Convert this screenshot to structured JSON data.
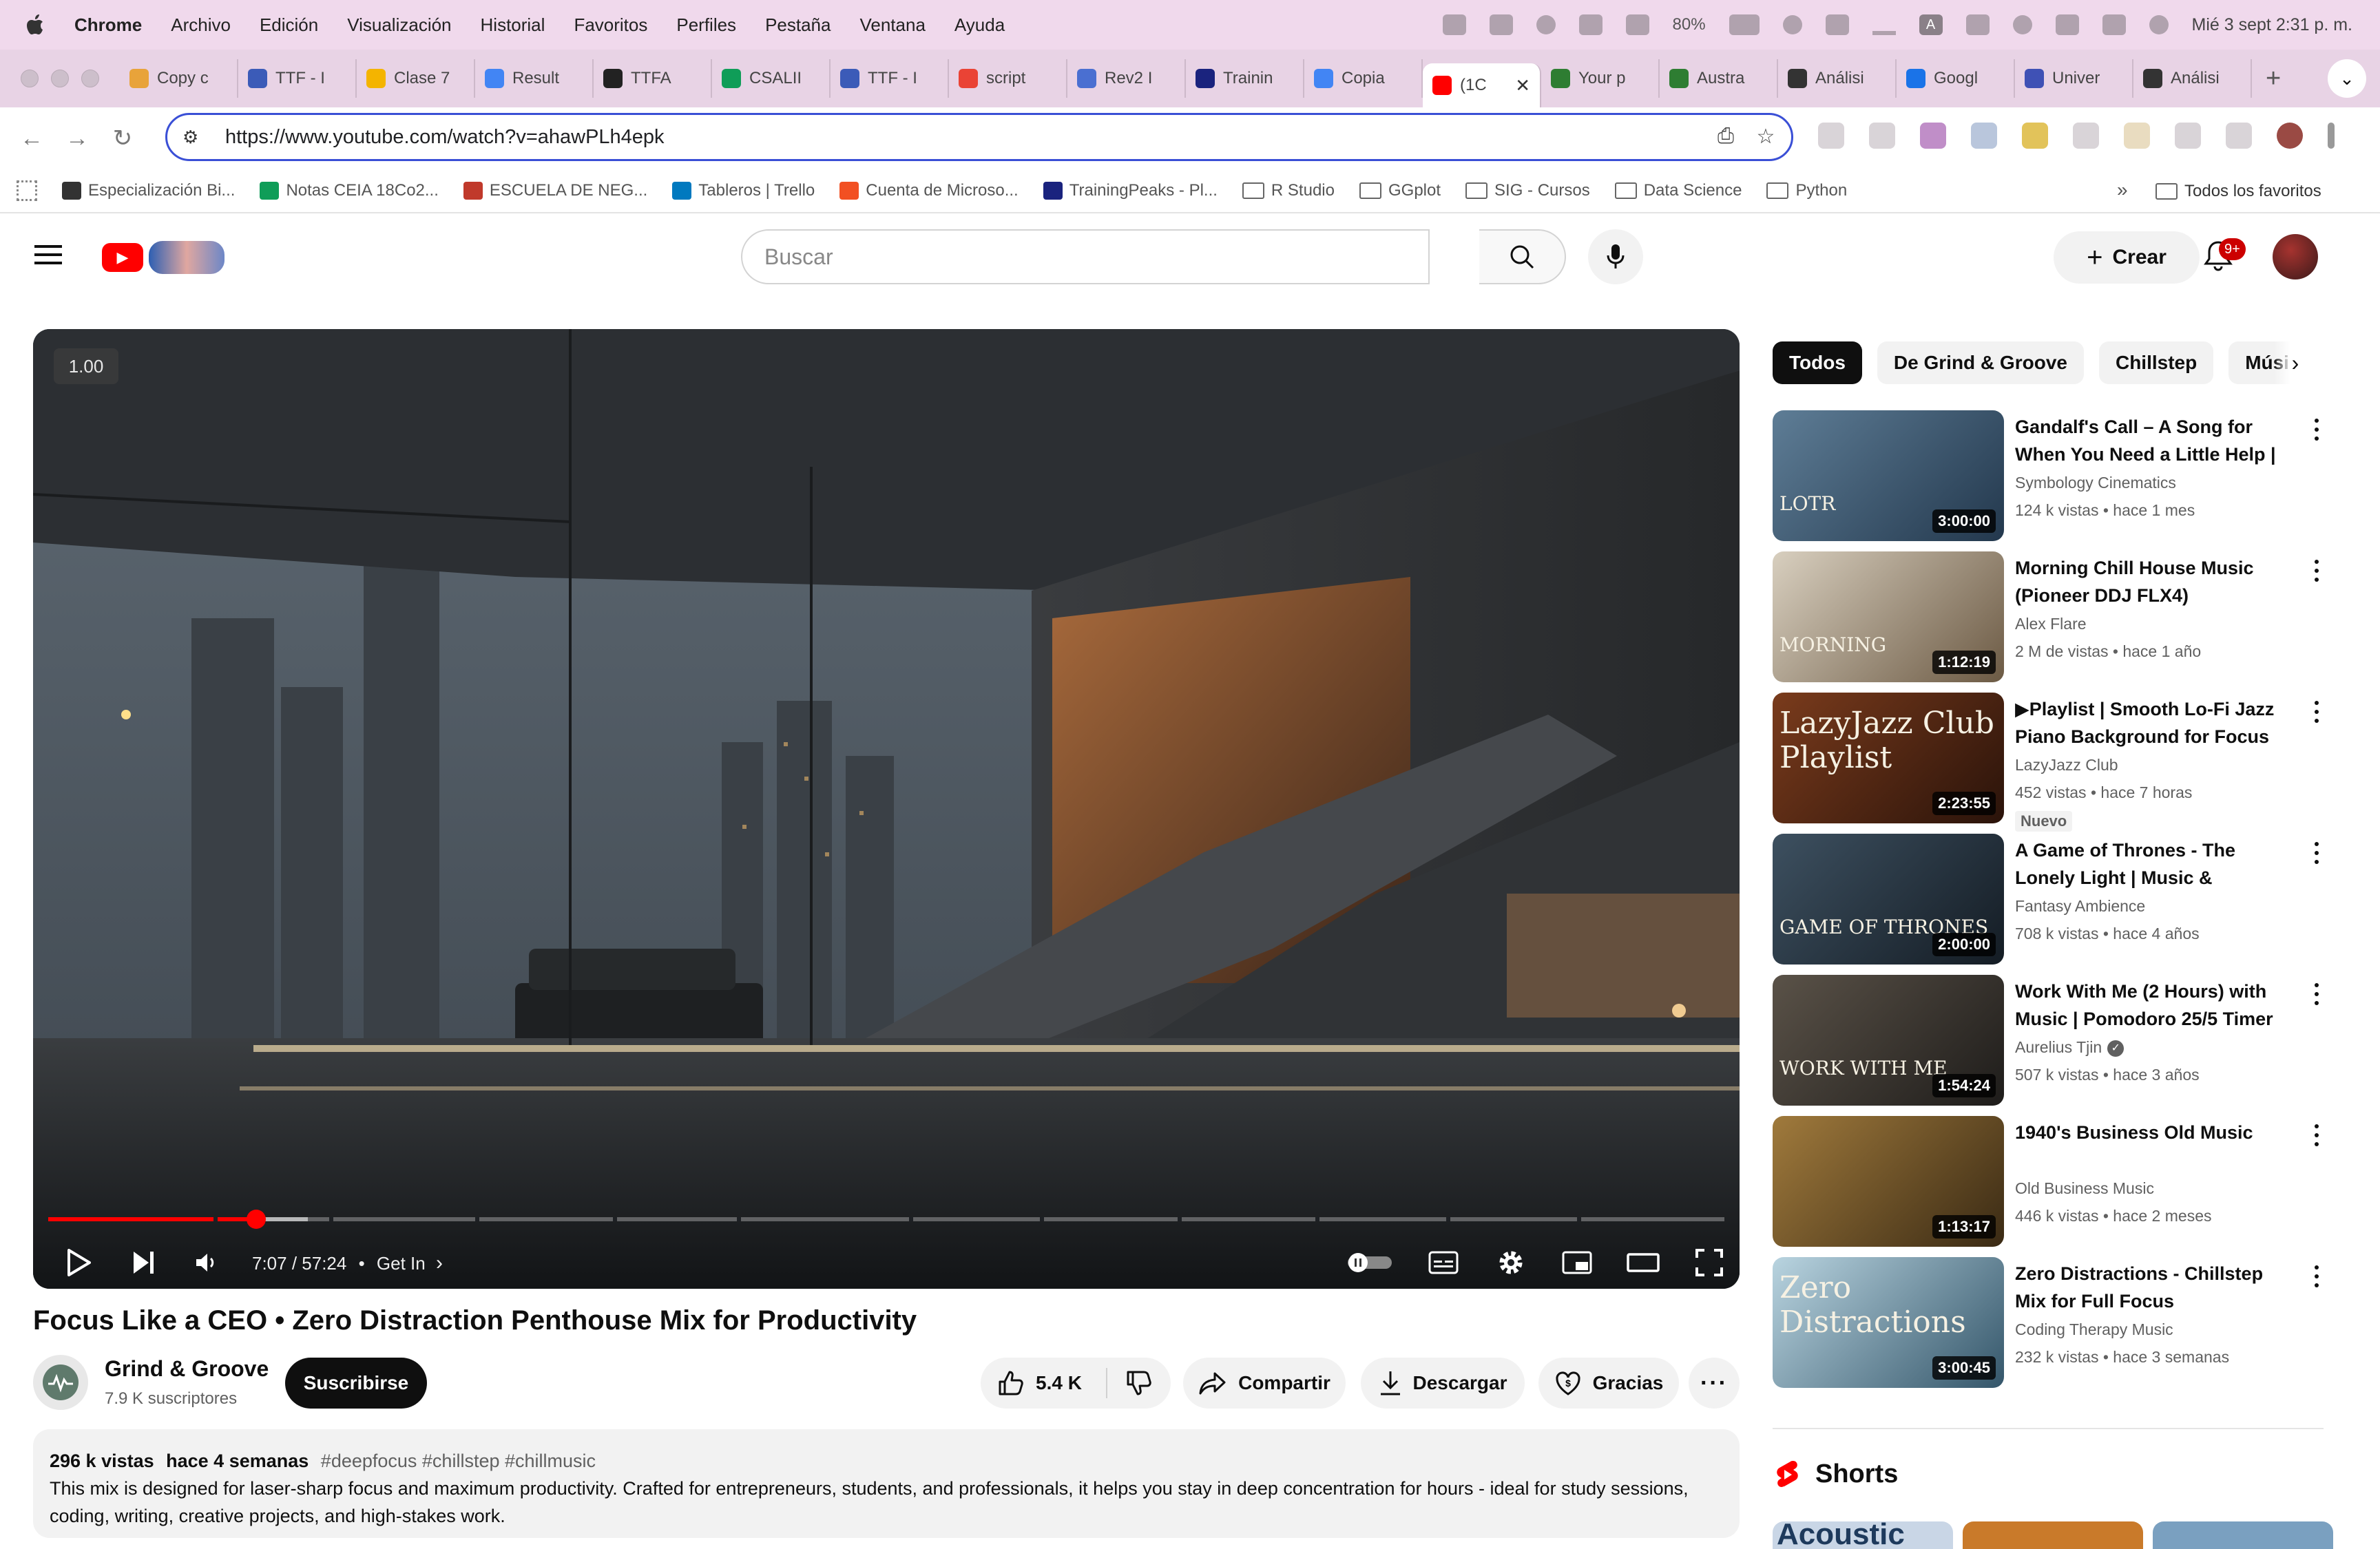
{
  "macos_menubar": {
    "app_name": "Chrome",
    "menus": [
      "Archivo",
      "Edición",
      "Visualización",
      "Historial",
      "Favoritos",
      "Perfiles",
      "Pestaña",
      "Ventana",
      "Ayuda"
    ],
    "battery": "80%",
    "status_initial": "A",
    "datetime": "Mié 3 sept  2:31 p. m."
  },
  "tabs": [
    {
      "label": "Copy c",
      "color": "#e8a33a"
    },
    {
      "label": "TTF - I",
      "color": "#3b5bb8"
    },
    {
      "label": "Clase 7",
      "color": "#f4b400"
    },
    {
      "label": "Result",
      "color": "#4285f4"
    },
    {
      "label": "TTFA",
      "color": "#222222"
    },
    {
      "label": "CSALII",
      "color": "#0f9d58"
    },
    {
      "label": "TTF - I",
      "color": "#3b5bb8"
    },
    {
      "label": "script",
      "color": "#ea4335"
    },
    {
      "label": "Rev2 I",
      "color": "#4a6fd1"
    },
    {
      "label": "Trainin",
      "color": "#1a237e"
    },
    {
      "label": "Copia",
      "color": "#4285f4"
    },
    {
      "label": "(1C",
      "color": "#ff0000",
      "active": true
    },
    {
      "label": "Your p",
      "color": "#2e7d32"
    },
    {
      "label": "Austra",
      "color": "#2e7d32"
    },
    {
      "label": "Análisi",
      "color": "#333333"
    },
    {
      "label": "Googl",
      "color": "#1a73e8"
    },
    {
      "label": "Univer",
      "color": "#3f51b5"
    },
    {
      "label": "Análisi",
      "color": "#333333"
    }
  ],
  "address": {
    "url": "https://www.youtube.com/watch?v=ahawPLh4epk"
  },
  "bookmarks": [
    {
      "label": "Especialización Bi...",
      "icon": "notion"
    },
    {
      "label": "Notas CEIA 18Co2...",
      "icon": "sheets"
    },
    {
      "label": "ESCUELA DE NEG...",
      "icon": "school"
    },
    {
      "label": "Tableros | Trello",
      "icon": "trello"
    },
    {
      "label": "Cuenta de Microso...",
      "icon": "microsoft"
    },
    {
      "label": "TrainingPeaks - Pl...",
      "icon": "trainingpeaks"
    },
    {
      "label": "R Studio",
      "icon": "folder"
    },
    {
      "label": "GGplot",
      "icon": "folder"
    },
    {
      "label": "SIG - Cursos",
      "icon": "folder"
    },
    {
      "label": "Data Science",
      "icon": "folder"
    },
    {
      "label": "Python",
      "icon": "folder"
    }
  ],
  "bookmarks_more": "»",
  "all_bookmarks": "Todos los favoritos",
  "youtube": {
    "search_placeholder": "Buscar",
    "create_label": "Crear",
    "notifications_count": "9+"
  },
  "player": {
    "speed": "1.00",
    "time": "7:07 / 57:24",
    "chapter": "Get In",
    "progress_fraction": 0.124,
    "buffered_fraction": 0.155
  },
  "video": {
    "title": "Focus Like a CEO • Zero Distraction Penthouse Mix for Productivity",
    "channel": "Grind & Groove",
    "subscribers": "7.9 K suscriptores",
    "subscribe_label": "Suscribirse",
    "likes": "5.4 K",
    "share_label": "Compartir",
    "download_label": "Descargar",
    "thanks_label": "Gracias",
    "views": "296 k vistas",
    "age": "hace 4 semanas",
    "tags": "#deepfocus #chillstep #chillmusic",
    "description": "This mix is designed for laser-sharp focus and maximum productivity. Crafted for entrepreneurs, students, and professionals, it helps you stay in deep concentration for hours - ideal for study sessions, coding, writing, creative projects, and high-stakes work."
  },
  "chips": [
    "Todos",
    "De Grind & Groove",
    "Chillstep",
    "Músi"
  ],
  "recommendations": [
    {
      "title": "Gandalf's Call – A Song for When You Need a Little Help | ...",
      "channel": "Symbology Cinematics",
      "views": "124 k vistas",
      "age": "hace 1 mes",
      "duration": "3:00:00",
      "thumb_colors": [
        "#5e7d96",
        "#23384d"
      ],
      "thumb_text": "LOTR"
    },
    {
      "title": "Morning Chill House Music (Pioneer DDJ FLX4)",
      "channel": "Alex Flare",
      "views": "2 M de vistas",
      "age": "hace 1 año",
      "duration": "1:12:19",
      "thumb_colors": [
        "#d8cfbf",
        "#6c5a44"
      ],
      "thumb_text": "MORNING"
    },
    {
      "title": "▶Playlist | Smooth Lo-Fi Jazz Piano Background for Focus &...",
      "channel": "LazyJazz Club",
      "views": "452 vistas",
      "age": "hace 7 horas",
      "duration": "2:23:55",
      "badge": "Nuevo",
      "thumb_colors": [
        "#7a3b1c",
        "#2a130a"
      ],
      "thumb_text": "LazyJazz Club Playlist"
    },
    {
      "title": "A Game of Thrones - The Lonely Light | Music & Ambience ...",
      "channel": "Fantasy Ambience",
      "views": "708 k vistas",
      "age": "hace 4 años",
      "duration": "2:00:00",
      "thumb_colors": [
        "#3d5060",
        "#141c24"
      ],
      "thumb_text": "GAME OF THRONES"
    },
    {
      "title": "Work With Me (2 Hours) with Music | Pomodoro 25/5 Timer ...",
      "channel": "Aurelius Tjin",
      "verified": true,
      "views": "507 k vistas",
      "age": "hace 3 años",
      "duration": "1:54:24",
      "thumb_colors": [
        "#5a5248",
        "#1e1c1a"
      ],
      "thumb_text": "WORK WITH ME"
    },
    {
      "title": "1940's Business Old Music",
      "channel": "Old Business Music",
      "views": "446 k vistas",
      "age": "hace 2 meses",
      "duration": "1:13:17",
      "thumb_colors": [
        "#a07a3c",
        "#3a2a14"
      ],
      "thumb_text": ""
    },
    {
      "title": "Zero Distractions - Chillstep Mix for Full Focus",
      "channel": "Coding Therapy Music",
      "views": "232 k vistas",
      "age": "hace 3 semanas",
      "duration": "3:00:45",
      "thumb_colors": [
        "#b9d4e0",
        "#34566a"
      ],
      "thumb_text": "Zero Distractions"
    }
  ],
  "shorts": {
    "title": "Shorts",
    "thumb_colors": [
      "#c9d6e6",
      "#c97a2a",
      "#7aa0c0"
    ],
    "first_caption": "Acoustic"
  }
}
